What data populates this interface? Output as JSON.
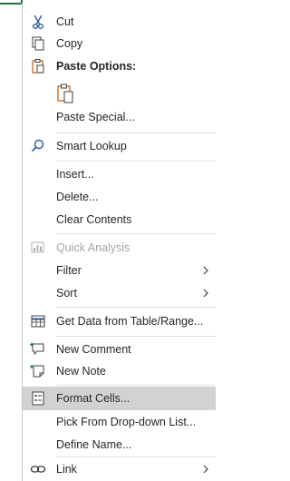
{
  "menu": {
    "cut": "Cut",
    "copy": "Copy",
    "paste_options": "Paste Options:",
    "paste_special": "Paste Special...",
    "smart_lookup": "Smart Lookup",
    "insert": "Insert...",
    "delete": "Delete...",
    "clear_contents": "Clear Contents",
    "quick_analysis": "Quick Analysis",
    "filter": "Filter",
    "sort": "Sort",
    "get_data": "Get Data from Table/Range...",
    "new_comment": "New Comment",
    "new_note": "New Note",
    "format_cells": "Format Cells...",
    "pick_dropdown": "Pick From Drop-down List...",
    "define_name": "Define Name...",
    "link": "Link"
  },
  "colors": {
    "highlight": "#d2d2d2",
    "cell_border": "#217346",
    "icon_blue": "#2b579a",
    "icon_orange": "#c55a11"
  },
  "icons": [
    "scissors-icon",
    "copy-icon",
    "clipboard-icon",
    "search-icon",
    "quick-analysis-icon",
    "table-icon",
    "comment-icon",
    "note-icon",
    "format-cells-icon",
    "link-icon",
    "chevron-right-icon"
  ]
}
